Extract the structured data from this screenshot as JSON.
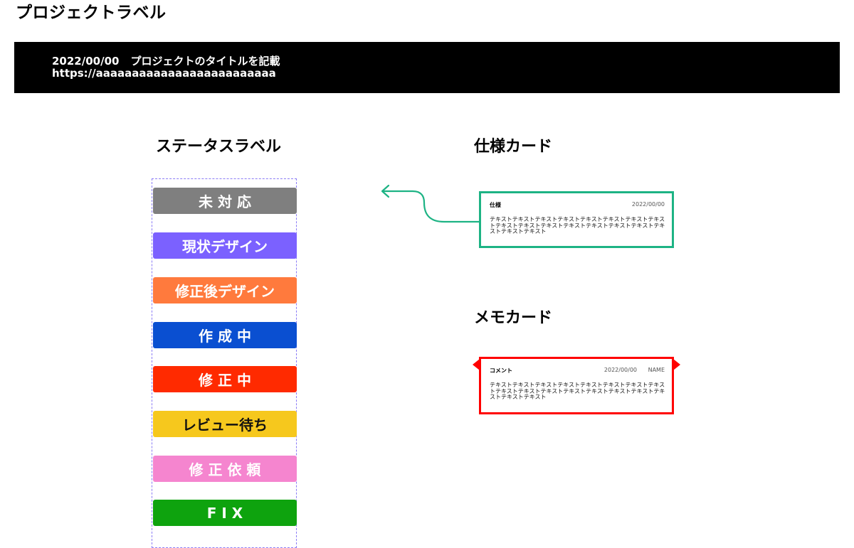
{
  "page_title": "プロジェクトラベル",
  "banner": {
    "date": "2022/00/00",
    "title": "プロジェクトのタイトルを記載",
    "url": "https://aaaaaaaaaaaaaaaaaaaaaaaaa"
  },
  "status_section": {
    "heading": "ステータスラベル",
    "labels": [
      {
        "text": "未 対 応",
        "color": "#7f7f7f"
      },
      {
        "text": "現状デザイン",
        "color": "#7b61ff"
      },
      {
        "text": "修正後デザイン",
        "color": "#ff7a3d"
      },
      {
        "text": "作 成 中",
        "color": "#0a4fd1"
      },
      {
        "text": "修 正 中",
        "color": "#ff2a00"
      },
      {
        "text": "レビュー待ち",
        "color": "#f6c81d",
        "text_color": "#111111"
      },
      {
        "text": "修 正 依 頼",
        "color": "#f585cf"
      },
      {
        "text": "F I X",
        "color": "#0ea30e"
      }
    ]
  },
  "spec_section": {
    "heading": "仕様カード",
    "card": {
      "label": "仕様",
      "date": "2022/00/00",
      "body": "テキストテキストテキストテキストテキストテキストテキストテキストテキストテキストテキストテキストテキストテキストテキストテキストテキストテキスト",
      "border_color": "#1db384"
    }
  },
  "memo_section": {
    "heading": "メモカード",
    "card": {
      "label": "コメント",
      "date": "2022/00/00",
      "name": "NAME",
      "body": "テキストテキストテキストテキストテキストテキストテキストテキストテキストテキストテキストテキストテキストテキストテキストテキストテキストテキスト",
      "border_color": "#ff0000"
    }
  }
}
